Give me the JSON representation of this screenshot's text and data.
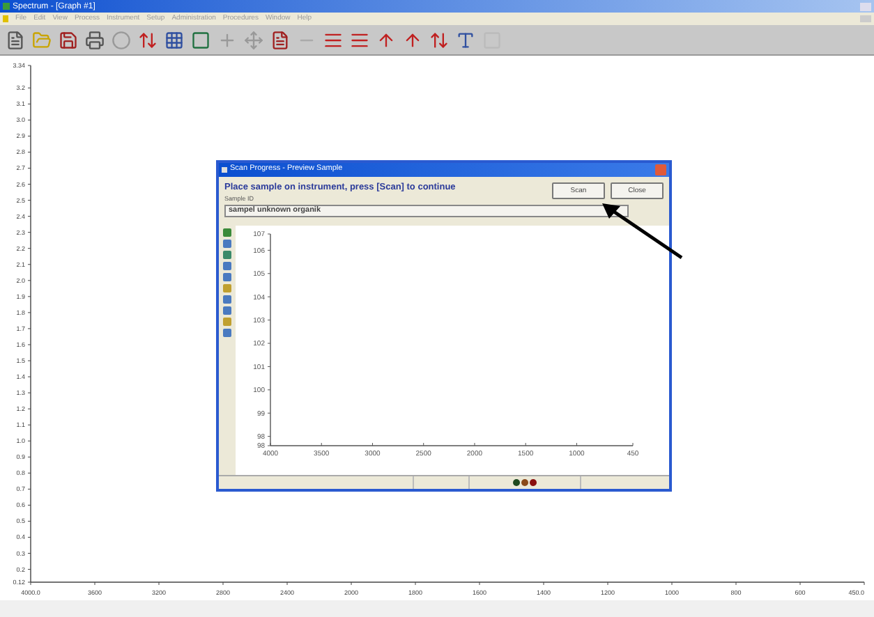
{
  "window": {
    "title": "Spectrum - [Graph #1]"
  },
  "menu": [
    "File",
    "Edit",
    "View",
    "Process",
    "Instrument",
    "Setup",
    "Administration",
    "Procedures",
    "Window",
    "Help"
  ],
  "graph": {
    "chart_data": {
      "type": "line",
      "ylim": [
        0.12,
        3.34
      ],
      "categories": [
        "4000.0",
        "3600",
        "3200",
        "2800",
        "2400",
        "2000",
        "1800",
        "1600",
        "1400",
        "1200",
        "1000",
        "800",
        "600",
        "450.0"
      ],
      "yticks": [
        {
          "value": 3.34,
          "label": "3.34"
        },
        {
          "value": 3.2,
          "label": "3.2"
        },
        {
          "value": 3.1,
          "label": "3.1"
        },
        {
          "value": 3.0,
          "label": "3.0"
        },
        {
          "value": 2.9,
          "label": "2.9"
        },
        {
          "value": 2.8,
          "label": "2.8"
        },
        {
          "value": 2.7,
          "label": "2.7"
        },
        {
          "value": 2.6,
          "label": "2.6"
        },
        {
          "value": 2.5,
          "label": "2.5"
        },
        {
          "value": 2.4,
          "label": "2.4"
        },
        {
          "value": 2.3,
          "label": "2.3"
        },
        {
          "value": 2.2,
          "label": "2.2"
        },
        {
          "value": 2.1,
          "label": "2.1"
        },
        {
          "value": 2.0,
          "label": "2.0"
        },
        {
          "value": 1.9,
          "label": "1.9"
        },
        {
          "value": 1.8,
          "label": "1.8"
        },
        {
          "value": 1.7,
          "label": "1.7"
        },
        {
          "value": 1.6,
          "label": "1.6"
        },
        {
          "value": 1.5,
          "label": "1.5"
        },
        {
          "value": 1.4,
          "label": "1.4"
        },
        {
          "value": 1.3,
          "label": "1.3"
        },
        {
          "value": 1.2,
          "label": "1.2"
        },
        {
          "value": 1.1,
          "label": "1.1"
        },
        {
          "value": 1.0,
          "label": "1.0"
        },
        {
          "value": 0.9,
          "label": "0.9"
        },
        {
          "value": 0.8,
          "label": "0.8"
        },
        {
          "value": 0.7,
          "label": "0.7"
        },
        {
          "value": 0.6,
          "label": "0.6"
        },
        {
          "value": 0.5,
          "label": "0.5"
        },
        {
          "value": 0.4,
          "label": "0.4"
        },
        {
          "value": 0.3,
          "label": "0.3"
        },
        {
          "value": 0.2,
          "label": "0.2"
        },
        {
          "value": 0.12,
          "label": "0.12"
        }
      ]
    }
  },
  "dialog": {
    "title": "Scan Progress - Preview Sample",
    "message": "Place sample on instrument, press [Scan] to continue",
    "sample_id_label": "Sample ID",
    "sample_id": "sampel unknown organik",
    "buttons": [
      "Scan",
      "Close"
    ],
    "chart_data": {
      "type": "line",
      "xlim": [
        4000,
        450
      ],
      "ylim": [
        97.6,
        106.7
      ],
      "xticks": [
        4000,
        3500,
        3000,
        2500,
        2000,
        1500,
        1000,
        450
      ],
      "yticks": [
        {
          "value": 106.7,
          "label": "107"
        },
        106,
        105,
        104,
        103,
        102,
        101,
        100,
        99,
        98,
        {
          "value": 97.6,
          "label": "98"
        }
      ]
    },
    "status_lights": [
      {
        "color": "#1f4a1f"
      },
      {
        "color": "#8a4a1a"
      },
      {
        "color": "#8a1010"
      }
    ]
  }
}
